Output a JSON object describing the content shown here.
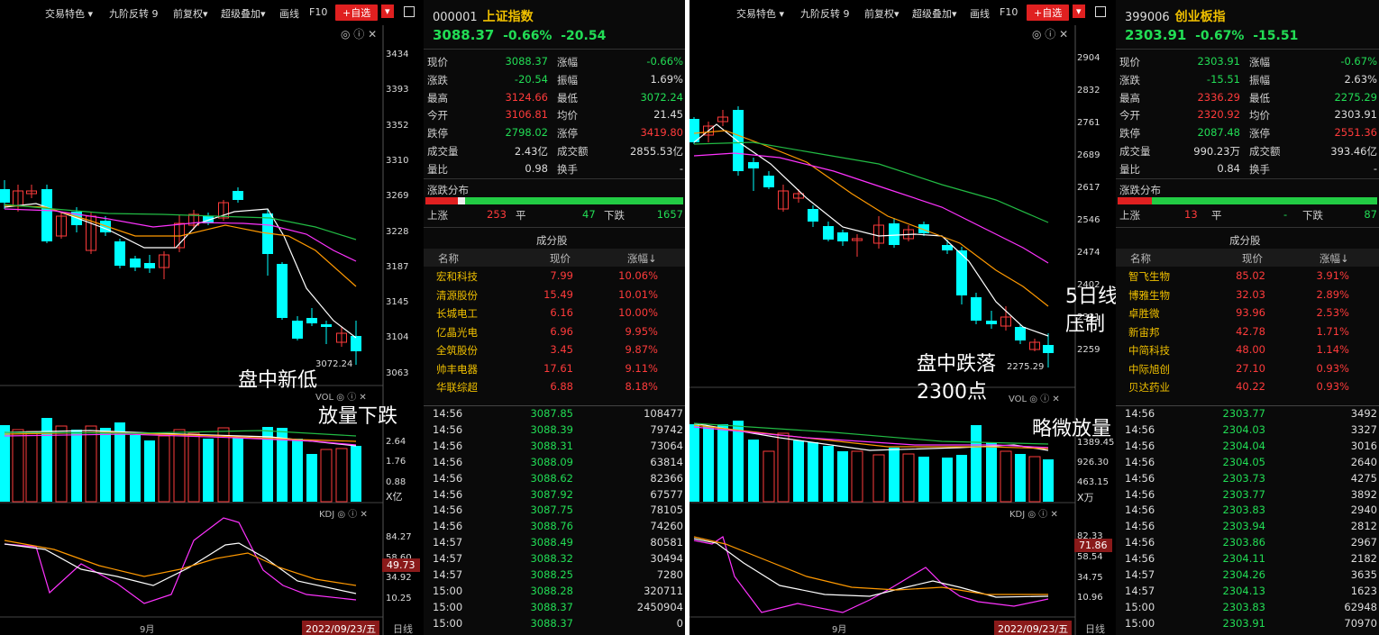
{
  "left": {
    "toolbar": [
      "交易特色 ▾",
      "九阶反转 9",
      "前复权▾",
      "超级叠加▾",
      "画线",
      "F10",
      "+自选",
      "▾"
    ],
    "price_ticks": [
      "3434",
      "3393",
      "3352",
      "3310",
      "3269",
      "3228",
      "3187",
      "3145",
      "3104",
      "3063"
    ],
    "low_label": "3072.24",
    "vol_title": "VOL",
    "vol_ticks": [
      "2.64",
      "1.76",
      "0.88",
      "X亿"
    ],
    "kdj_title": "KDJ",
    "kdj_ticks": [
      "84.27",
      "58.60",
      "34.92",
      "10.25"
    ],
    "kdj_current": "49.73",
    "month": "9月",
    "date": "2022/09/23/五",
    "period": "日线",
    "ann1": "盘中新低",
    "ann2": "放量下跌",
    "info": {
      "code": "000001",
      "name": "上证指数",
      "price": "3088.37",
      "chg_pct": "-0.66%",
      "chg": "-20.54",
      "stats": [
        [
          "现价",
          "3088.37",
          "涨幅",
          "-0.66%"
        ],
        [
          "涨跌",
          "-20.54",
          "振幅",
          "1.69%"
        ],
        [
          "最高",
          "3124.66",
          "最低",
          "3072.24"
        ],
        [
          "今开",
          "3106.81",
          "均价",
          "21.45"
        ],
        [
          "跌停",
          "2798.02",
          "涨停",
          "3419.80"
        ],
        [
          "成交量",
          "2.43亿",
          "成交额",
          "2855.53亿"
        ],
        [
          "量比",
          "0.98",
          "换手",
          "-"
        ]
      ],
      "dist_title": "涨跌分布",
      "dist": [
        "上涨",
        "253",
        "平",
        "47",
        "下跌",
        "1657"
      ],
      "comp_title": "成分股",
      "comp_headers": [
        "名称",
        "现价",
        "涨幅↓"
      ],
      "comps": [
        [
          "宏和科技",
          "7.99",
          "10.06%"
        ],
        [
          "清源股份",
          "15.49",
          "10.01%"
        ],
        [
          "长城电工",
          "6.16",
          "10.00%"
        ],
        [
          "亿晶光电",
          "6.96",
          "9.95%"
        ],
        [
          "全筑股份",
          "3.45",
          "9.87%"
        ],
        [
          "帅丰电器",
          "17.61",
          "9.11%"
        ],
        [
          "华联综超",
          "6.88",
          "8.18%"
        ]
      ],
      "ticks": [
        [
          "14:56",
          "3087.85",
          "108477"
        ],
        [
          "14:56",
          "3088.39",
          "79742"
        ],
        [
          "14:56",
          "3088.31",
          "73064"
        ],
        [
          "14:56",
          "3088.09",
          "63814"
        ],
        [
          "14:56",
          "3088.62",
          "82366"
        ],
        [
          "14:56",
          "3087.92",
          "67577"
        ],
        [
          "14:56",
          "3087.75",
          "78105"
        ],
        [
          "14:56",
          "3088.76",
          "74260"
        ],
        [
          "14:57",
          "3088.49",
          "80581"
        ],
        [
          "14:57",
          "3088.32",
          "30494"
        ],
        [
          "14:57",
          "3088.25",
          "7280"
        ],
        [
          "15:00",
          "3088.28",
          "320711"
        ],
        [
          "15:00",
          "3088.37",
          "2450904"
        ],
        [
          "15:00",
          "3088.37",
          "0"
        ]
      ]
    }
  },
  "right": {
    "toolbar": [
      "交易特色 ▾",
      "九阶反转 9",
      "前复权▾",
      "超级叠加▾",
      "画线",
      "F10",
      "+自选",
      "▾"
    ],
    "price_ticks": [
      "2904",
      "2832",
      "2761",
      "2689",
      "2617",
      "2546",
      "2474",
      "2402",
      "2331",
      "2259"
    ],
    "low_label": "2275.29",
    "vol_title": "VOL",
    "vol_ticks": [
      "1389.45",
      "926.30",
      "463.15",
      "X万"
    ],
    "kdj_title": "KDJ",
    "kdj_ticks": [
      "82.33",
      "58.54",
      "34.75",
      "10.96"
    ],
    "kdj_current": "71.86",
    "month": "9月",
    "date": "2022/09/23/五",
    "period": "日线",
    "ann1": "盘中跌落",
    "ann2": "2300点",
    "ann3": "5日线",
    "ann4": "压制",
    "ann5": "略微放量",
    "info": {
      "code": "399006",
      "name": "创业板指",
      "price": "2303.91",
      "chg_pct": "-0.67%",
      "chg": "-15.51",
      "stats": [
        [
          "现价",
          "2303.91",
          "涨幅",
          "-0.67%"
        ],
        [
          "涨跌",
          "-15.51",
          "振幅",
          "2.63%"
        ],
        [
          "最高",
          "2336.29",
          "最低",
          "2275.29"
        ],
        [
          "今开",
          "2320.92",
          "均价",
          "2303.91"
        ],
        [
          "跌停",
          "2087.48",
          "涨停",
          "2551.36"
        ],
        [
          "成交量",
          "990.23万",
          "成交额",
          "393.46亿"
        ],
        [
          "量比",
          "0.84",
          "换手",
          "-"
        ]
      ],
      "dist_title": "涨跌分布",
      "dist": [
        "上涨",
        "13",
        "平",
        "-",
        "下跌",
        "87"
      ],
      "comp_title": "成分股",
      "comp_headers": [
        "名称",
        "现价",
        "涨幅↓"
      ],
      "comps": [
        [
          "智飞生物",
          "85.02",
          "3.91%"
        ],
        [
          "博雅生物",
          "32.03",
          "2.89%"
        ],
        [
          "卓胜微",
          "93.96",
          "2.53%"
        ],
        [
          "新宙邦",
          "42.78",
          "1.71%"
        ],
        [
          "中简科技",
          "48.00",
          "1.14%"
        ],
        [
          "中际旭创",
          "27.10",
          "0.93%"
        ],
        [
          "贝达药业",
          "40.22",
          "0.93%"
        ]
      ],
      "ticks": [
        [
          "14:56",
          "2303.77",
          "3492"
        ],
        [
          "14:56",
          "2304.03",
          "3327"
        ],
        [
          "14:56",
          "2304.04",
          "3016"
        ],
        [
          "14:56",
          "2304.05",
          "2640"
        ],
        [
          "14:56",
          "2303.73",
          "4275"
        ],
        [
          "14:56",
          "2303.77",
          "3892"
        ],
        [
          "14:56",
          "2303.83",
          "2940"
        ],
        [
          "14:56",
          "2303.94",
          "2812"
        ],
        [
          "14:56",
          "2303.86",
          "2967"
        ],
        [
          "14:56",
          "2304.11",
          "2182"
        ],
        [
          "14:57",
          "2304.26",
          "3635"
        ],
        [
          "14:57",
          "2304.13",
          "1623"
        ],
        [
          "15:00",
          "2303.83",
          "62948"
        ],
        [
          "15:00",
          "2303.91",
          "70970"
        ]
      ]
    }
  }
}
